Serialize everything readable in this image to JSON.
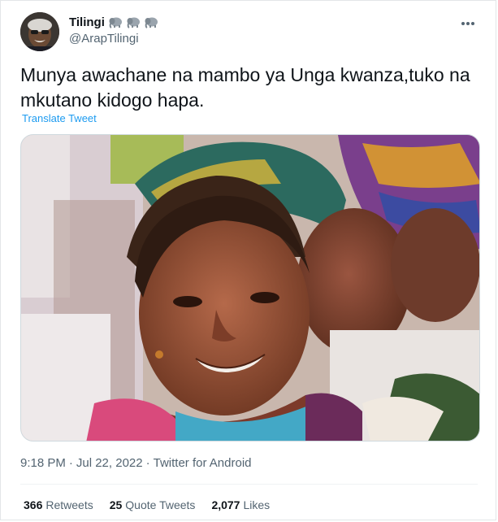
{
  "author": {
    "display_name": "Tilingi",
    "handle": "@ArapTilingi",
    "name_emojis": [
      "elephant-emoji",
      "elephant-emoji",
      "elephant-emoji"
    ],
    "more_icon": "more-horizontal-icon"
  },
  "tweet": {
    "text": "Munya awachane na mambo ya Unga kwanza,tuko na mkutano kidogo hapa.",
    "translate_label": "Translate Tweet"
  },
  "media": {
    "type": "photo"
  },
  "meta": {
    "time": "9:18 PM",
    "separator1": "·",
    "date": "Jul 22, 2022",
    "separator2": "·",
    "source": "Twitter for Android"
  },
  "stats": [
    {
      "count": "366",
      "label": "Retweets"
    },
    {
      "count": "25",
      "label": "Quote Tweets"
    },
    {
      "count": "2,077",
      "label": "Likes"
    }
  ],
  "colors": {
    "link": "#1d9bf0",
    "text": "#0f1419",
    "secondary": "#536471"
  }
}
